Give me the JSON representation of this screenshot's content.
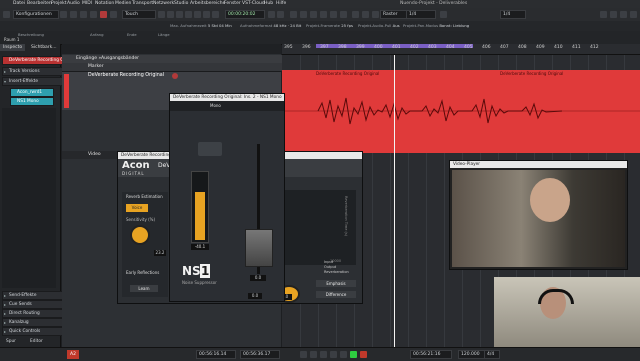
{
  "app": {
    "menu": [
      "Datei",
      "Bearbeiten",
      "Projekt",
      "Audio",
      "MIDI",
      "Notation",
      "Medien",
      "Transport",
      "Netzwerk",
      "Studio",
      "Arbeitsbereiche",
      "Fenster",
      "VST-Cloud",
      "Hub",
      "Hilfe"
    ],
    "window_title": "Nuendo-Projekt - Deliverables"
  },
  "toolbar": {
    "workspace": "Konfigurationen",
    "touch_mode": "Touch",
    "time_display": "00:00:20:02",
    "raster_label": "Raster",
    "raster_value": "1/4"
  },
  "infobar": {
    "fields": [
      {
        "k": "Max. Aufnahmezeit",
        "v": "5 Std 04 Min"
      },
      {
        "k": "Aufnahmeformat",
        "v": "48 kHz · 24 Bit"
      },
      {
        "k": "Projekt-Framerate",
        "v": "25 fps"
      },
      {
        "k": "Projekt-Audio-Pull",
        "v": "Aus"
      },
      {
        "k": "Projekt-Pan-Modus",
        "v": "Bonnt: Lieblung"
      }
    ]
  },
  "track_list_header": {
    "left": "Beschreibung",
    "mid": "Anfang",
    "end": "Ende",
    "len": "Länge",
    "room": "Raum 1"
  },
  "inspector": {
    "tabs": [
      "Inspecto",
      "Sichtbark..."
    ],
    "track_name": "DeVerberate Recording Original",
    "sections": [
      "Track Versions",
      "Insert-Effekte"
    ],
    "inserts": [
      "Acon_rwrd1",
      "NS1 Mono"
    ],
    "bottom_sections": [
      "Send-Effekte",
      "Cue Sends",
      "Direct Routing",
      "Kanalzug",
      "Quick Controls"
    ],
    "footer_tabs": [
      "Spur",
      "Editor"
    ]
  },
  "tracks": {
    "folder": "Eingänge »Ausgangsbänder",
    "marker": "Marker",
    "audio": "DeVerberate Recording Original",
    "video": "Video"
  },
  "ruler": {
    "ticks": [
      "395",
      "396",
      "397",
      "398",
      "399",
      "400",
      "401",
      "402",
      "403",
      "404",
      "405",
      "406",
      "407",
      "408",
      "409",
      "410",
      "411",
      "412"
    ]
  },
  "events": {
    "audio_label": "DeVerberate Recording Original"
  },
  "plugin_ns1": {
    "title": "DeVerberate Recording Original: Ins. 2 - NS1 Mono",
    "preset": "Mono",
    "meter_value": "-40.1",
    "fader_value": "0.0",
    "logo": "NS",
    "logo_num": "1",
    "subtitle": "Noise Suppressor",
    "footer_value": "0.0"
  },
  "plugin_acon": {
    "title": "DeVerberate Recording Original",
    "brand": "Acon",
    "brand_sub": "DIGITAL",
    "product": "DeVe",
    "section": "Reverb Estimation",
    "mode_btn": "Voice",
    "sensitivity_label": "Sensitivity (%)",
    "sensitivity_value": "23.2",
    "early_label": "Early Reflections",
    "learn_btn": "Learn",
    "legend": [
      "Input",
      "Output",
      "Reverberation"
    ],
    "btn_emphasis": "Emphasis",
    "btn_difference": "Difference",
    "axis_label": "Reverberation Time (s)",
    "freq_tick": "10000",
    "footer_value": "0.0"
  },
  "video_player": {
    "title": "Video-Player"
  },
  "transport": {
    "left_time": "00:56:16.14",
    "mid_time": "00:56:36.17",
    "right_time": "00:56:21:16",
    "tempo": "120.000",
    "signature": "4/4",
    "status_a": "A2"
  },
  "colors": {
    "audio_event": "#e03a3a",
    "cycle": "#7a5fc4",
    "insert_active": "#2e9fae",
    "ns1_meter": "#e8a322",
    "acon_voice": "#e8a322"
  }
}
